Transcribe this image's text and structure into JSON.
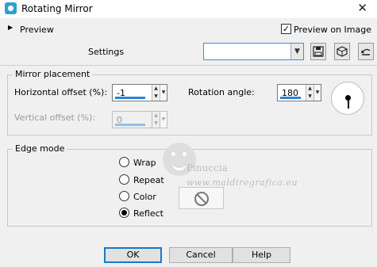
{
  "window": {
    "title": "Rotating Mirror",
    "close_glyph": "✕"
  },
  "preview": {
    "toggle_glyph": "▶",
    "label": "Preview",
    "preview_on_image_label": "Preview on Image",
    "preview_on_image_checked": true
  },
  "settings": {
    "label": "Settings",
    "value": "",
    "tools": [
      "save-preset-icon",
      "reset-cube-icon",
      "restore-defaults-icon"
    ]
  },
  "mirror_placement": {
    "title": "Mirror placement",
    "horizontal_offset": {
      "label": "Horizontal offset (%):",
      "value": "-1",
      "enabled": true
    },
    "vertical_offset": {
      "label": "Vertical offset (%):",
      "value": "0",
      "enabled": false
    },
    "rotation_angle": {
      "label": "Rotation angle:",
      "value": "180",
      "enabled": true
    }
  },
  "edge_mode": {
    "title": "Edge mode",
    "options": [
      {
        "label": "Wrap",
        "selected": false
      },
      {
        "label": "Repeat",
        "selected": false
      },
      {
        "label": "Color",
        "selected": false
      },
      {
        "label": "Reflect",
        "selected": true
      }
    ]
  },
  "watermark": {
    "line1": "Pinuccia",
    "line2": "www.maldiregrafica.eu"
  },
  "buttons": {
    "ok": "OK",
    "cancel": "Cancel",
    "help": "Help"
  },
  "colors": {
    "accent": "#2b82d9",
    "window_bg": "#f0f0f0",
    "app_icon": "#2aa3c9"
  }
}
